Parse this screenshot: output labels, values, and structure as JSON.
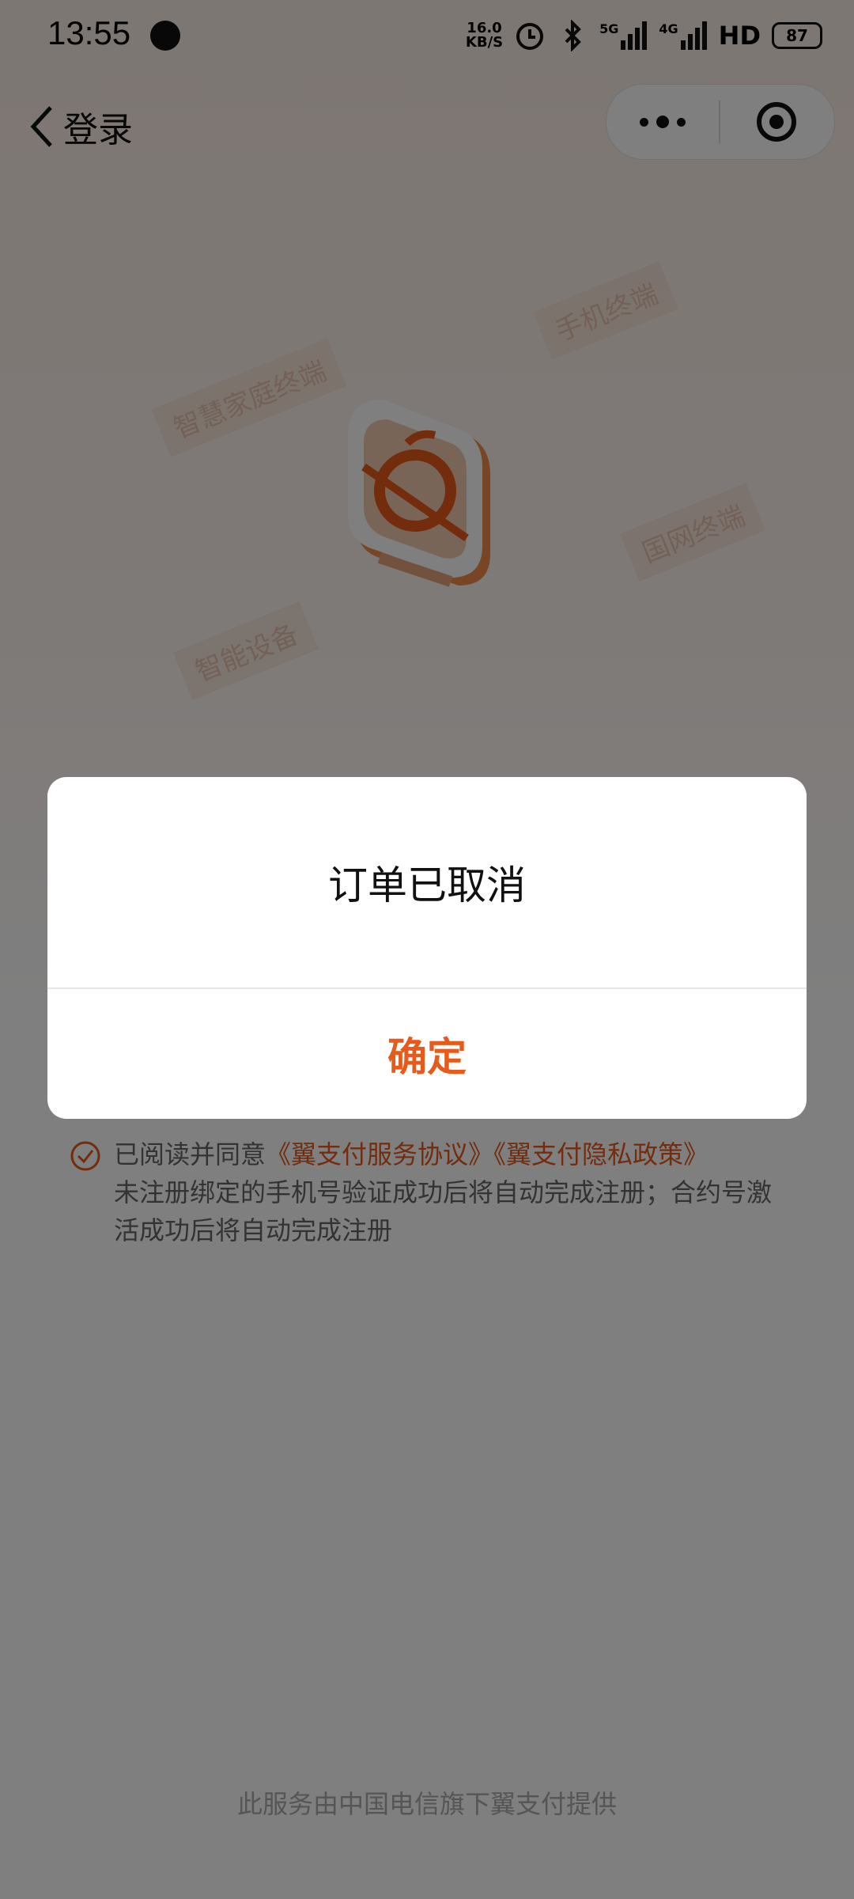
{
  "status_bar": {
    "time": "13:55",
    "net_speed_value": "16.0",
    "net_speed_unit": "KB/S",
    "signal_5g": "5G",
    "signal_4g": "4G",
    "hd": "HD",
    "battery": "87"
  },
  "nav": {
    "title": "登录"
  },
  "hero": {
    "labels": [
      "智慧家庭终端",
      "手机终端",
      "国网终端",
      "智能设备"
    ]
  },
  "agreement": {
    "prefix": "已阅读并同意",
    "link1": "《翼支付服务协议》",
    "link2": "《翼支付隐私政策》",
    "notice": "未注册绑定的手机号验证成功后将自动完成注册；合约号激活成功后将自动完成注册"
  },
  "footer": {
    "text": "此服务由中国电信旗下翼支付提供"
  },
  "dialog": {
    "title": "订单已取消",
    "confirm": "确定"
  },
  "colors": {
    "accent": "#e65a1b",
    "mask": "rgba(0,0,0,0.5)"
  }
}
